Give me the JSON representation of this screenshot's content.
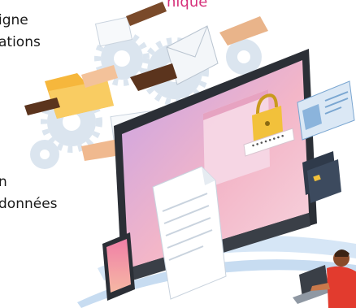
{
  "texts": {
    "heading_fragment": "nique",
    "line_1": "igne",
    "line_2": "ations",
    "line_3": "n",
    "line_4": "données"
  },
  "colors": {
    "accent": "#d6307a",
    "gear": "#dbe5ef",
    "monitor_frame": "#2b2f36",
    "screen_pink": "#f3b6c8",
    "screen_violet": "#c7a2e6",
    "padlock": "#f2c13b",
    "folder": "#f6b73c",
    "id_card": "#dbe8f5",
    "swoosh": "#b9d3ee",
    "shirt": "#e23b2e"
  },
  "icons": [
    "gear-icon",
    "folder-icon",
    "envelope-icon",
    "padlock-icon",
    "id-card-icon",
    "credit-card-icon",
    "document-icon",
    "tablet-icon",
    "laptop-icon",
    "handshake-icon"
  ]
}
